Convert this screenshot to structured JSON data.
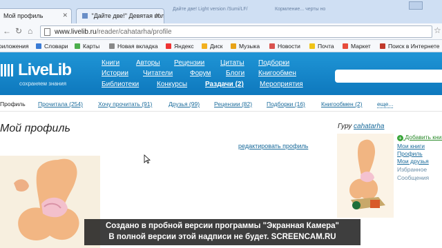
{
  "browser": {
    "tabs": [
      {
        "title": "Мой профиль"
      },
      {
        "title": "\"Дайте две!\" Девятая вол"
      }
    ],
    "faded_tabs": [
      "Дайте две! Light version /Sumi/LF/",
      "Кормление... черты но"
    ],
    "url": {
      "domain": "www.livelib.ru",
      "path": "/reader/cahatarha/profile"
    },
    "bookmarks": [
      "риложения",
      "Словари",
      "Карты",
      "Новая вкладка",
      "Яндекс",
      "Диск",
      "Музыка",
      "Новости",
      "Почта",
      "Маркет",
      "Поиск в Интернете"
    ]
  },
  "site": {
    "logo": "LiveLib",
    "tagline": "сохраняем знания",
    "menu_row1": [
      "Книги",
      "Авторы",
      "Рецензии",
      "Цитаты",
      "Подборки"
    ],
    "menu_row2": [
      "Истории",
      "Читатели",
      "Форум",
      "Блоги",
      "Книгообмен"
    ],
    "menu_row3": [
      "Библиотеки",
      "Конкурсы",
      "Раздачи (2)",
      "Мероприятия"
    ]
  },
  "subnav": {
    "current": "Профиль",
    "links": [
      "Прочитала (254)",
      "Хочу прочитать (91)",
      "Друзья (99)",
      "Рецензии (82)",
      "Подборки (16)",
      "Книгообмен (2)"
    ],
    "more": "еще..."
  },
  "profile": {
    "title": "Мой профиль",
    "edit_link": "редактировать профиль",
    "guru_label": "Гуру",
    "username": "cahatarha",
    "side_links": {
      "add": "Добавить книгу",
      "my_books": "Мои книги",
      "profile": "Профиль",
      "my_friends": "Мои друзья",
      "favorites": "Избранное",
      "messages": "Сообщения"
    }
  },
  "watermark": {
    "line1": "Создано в пробной версии программы \"Экранная Камера\"",
    "line2": "В полной версии этой надписи не будет. SCREENCAM.RU"
  },
  "colors": {
    "header_blue": "#1387c8",
    "link_blue": "#1a6b9b",
    "add_green": "#2a8a2a"
  }
}
